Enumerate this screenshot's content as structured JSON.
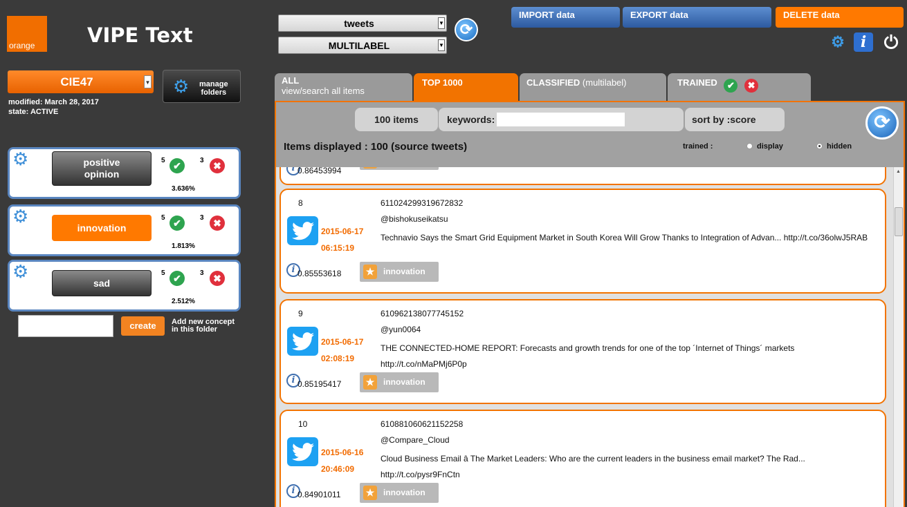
{
  "app": {
    "brand": "orange",
    "title": "VIPE Text"
  },
  "folder": {
    "selected": "CIE47",
    "modified": "modified: March 28, 2017",
    "state": "state: ACTIVE",
    "manage_label_1": "manage",
    "manage_label_2": "folders"
  },
  "concepts": [
    {
      "label_1": "positive",
      "label_2": "opinion",
      "pos": "5",
      "neg": "3",
      "pct": "3.636%"
    },
    {
      "label": "innovation",
      "pos": "5",
      "neg": "3",
      "pct": "1.813%"
    },
    {
      "label": "sad",
      "pos": "5",
      "neg": "3",
      "pct": "2.512%"
    }
  ],
  "new_concept": {
    "create_label": "create",
    "hint_1": "Add new concept",
    "hint_2": "in this folder"
  },
  "source_select": "tweets",
  "mode_select": "MULTILABEL",
  "top_buttons": {
    "import": "IMPORT data",
    "export": "EXPORT data",
    "delete": "DELETE data"
  },
  "tabs": {
    "all_title": "ALL",
    "all_sub": "view/search all items",
    "top": "TOP 1000",
    "classified": "CLASSIFIED",
    "classified_sub": "(multilabel)",
    "trained": "TRAINED"
  },
  "toolbar": {
    "items_count": "100 items",
    "keywords_label": "keywords:",
    "sort_label": "sort by :score",
    "items_displayed": "Items displayed : 100 (source tweets)",
    "trained_label": "trained :",
    "display_label": "display",
    "hidden_label": "hidden",
    "trained_view": "hidden"
  },
  "partial_item": {
    "score": "0.86453994"
  },
  "items": [
    {
      "num": "8",
      "id": "611024299319672832",
      "user": "@bishokuseikatsu",
      "date": "2015-06-17",
      "time": "06:15:19",
      "text": "Technavio Says the Smart Grid Equipment Market in South Korea Will Grow Thanks to Integration of Advan... http://t.co/36olwJ5RAB",
      "score": "0.85553618",
      "tag": "innovation"
    },
    {
      "num": "9",
      "id": "610962138077745152",
      "user": "@yun0064",
      "date": "2015-06-17",
      "time": "02:08:19",
      "text": "THE CONNECTED-HOME REPORT: Forecasts and growth trends for one of the top ´Internet of Things´ markets http://t.co/nMaPMj6P0p",
      "score": "0.85195417",
      "tag": "innovation"
    },
    {
      "num": "10",
      "id": "610881060621152258",
      "user": "@Compare_Cloud",
      "date": "2015-06-16",
      "time": "20:46:09",
      "text": "Cloud Business Email â The Market Leaders: Who are the current leaders in the business email market? The Rad... http://t.co/pysr9FnCtn",
      "score": "0.84901011",
      "tag": "innovation"
    }
  ],
  "colors": {
    "accent": "#ff7900",
    "panel_border": "#f27300",
    "date": "#f26b00",
    "twitter": "#1da1f2",
    "blue_button": "#3d6cb4"
  },
  "icons": {
    "refresh": "refresh-icon",
    "gear": "gear-icon",
    "info": "info-icon",
    "power": "power-icon",
    "twitter": "twitter-icon",
    "ok": "check-icon",
    "ko": "cross-icon",
    "badge": "award-icon"
  }
}
